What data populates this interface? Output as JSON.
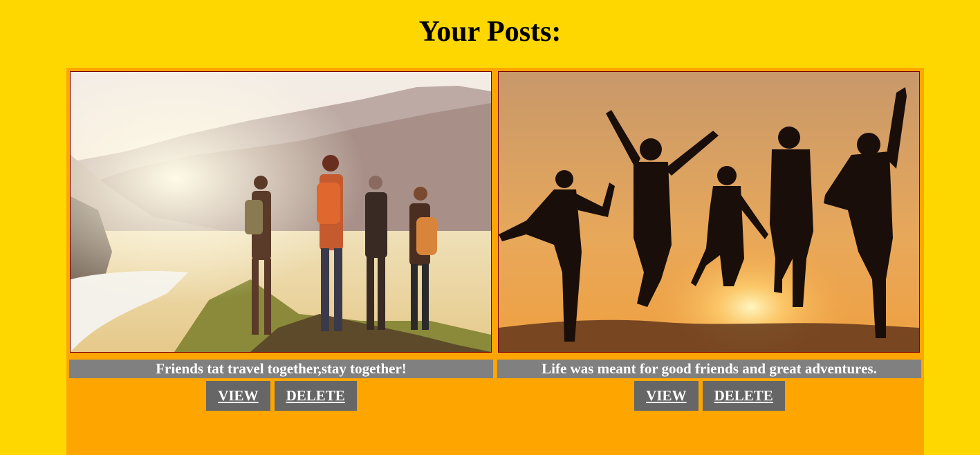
{
  "page": {
    "title": "Your Posts:"
  },
  "colors": {
    "page_background": "#FFD700",
    "container_background": "#FFA500",
    "caption_background": "#808080",
    "button_background": "#666666",
    "text_light": "#FFFFFF"
  },
  "posts": [
    {
      "caption": "Friends tat travel together,stay together!",
      "image": "photo-friends-hiking-mountains",
      "view_label": "VIEW",
      "delete_label": "DELETE"
    },
    {
      "caption": "Life was meant for good friends and great adventures.",
      "image": "photo-friends-jumping-sunset",
      "view_label": "VIEW",
      "delete_label": "DELETE"
    }
  ]
}
